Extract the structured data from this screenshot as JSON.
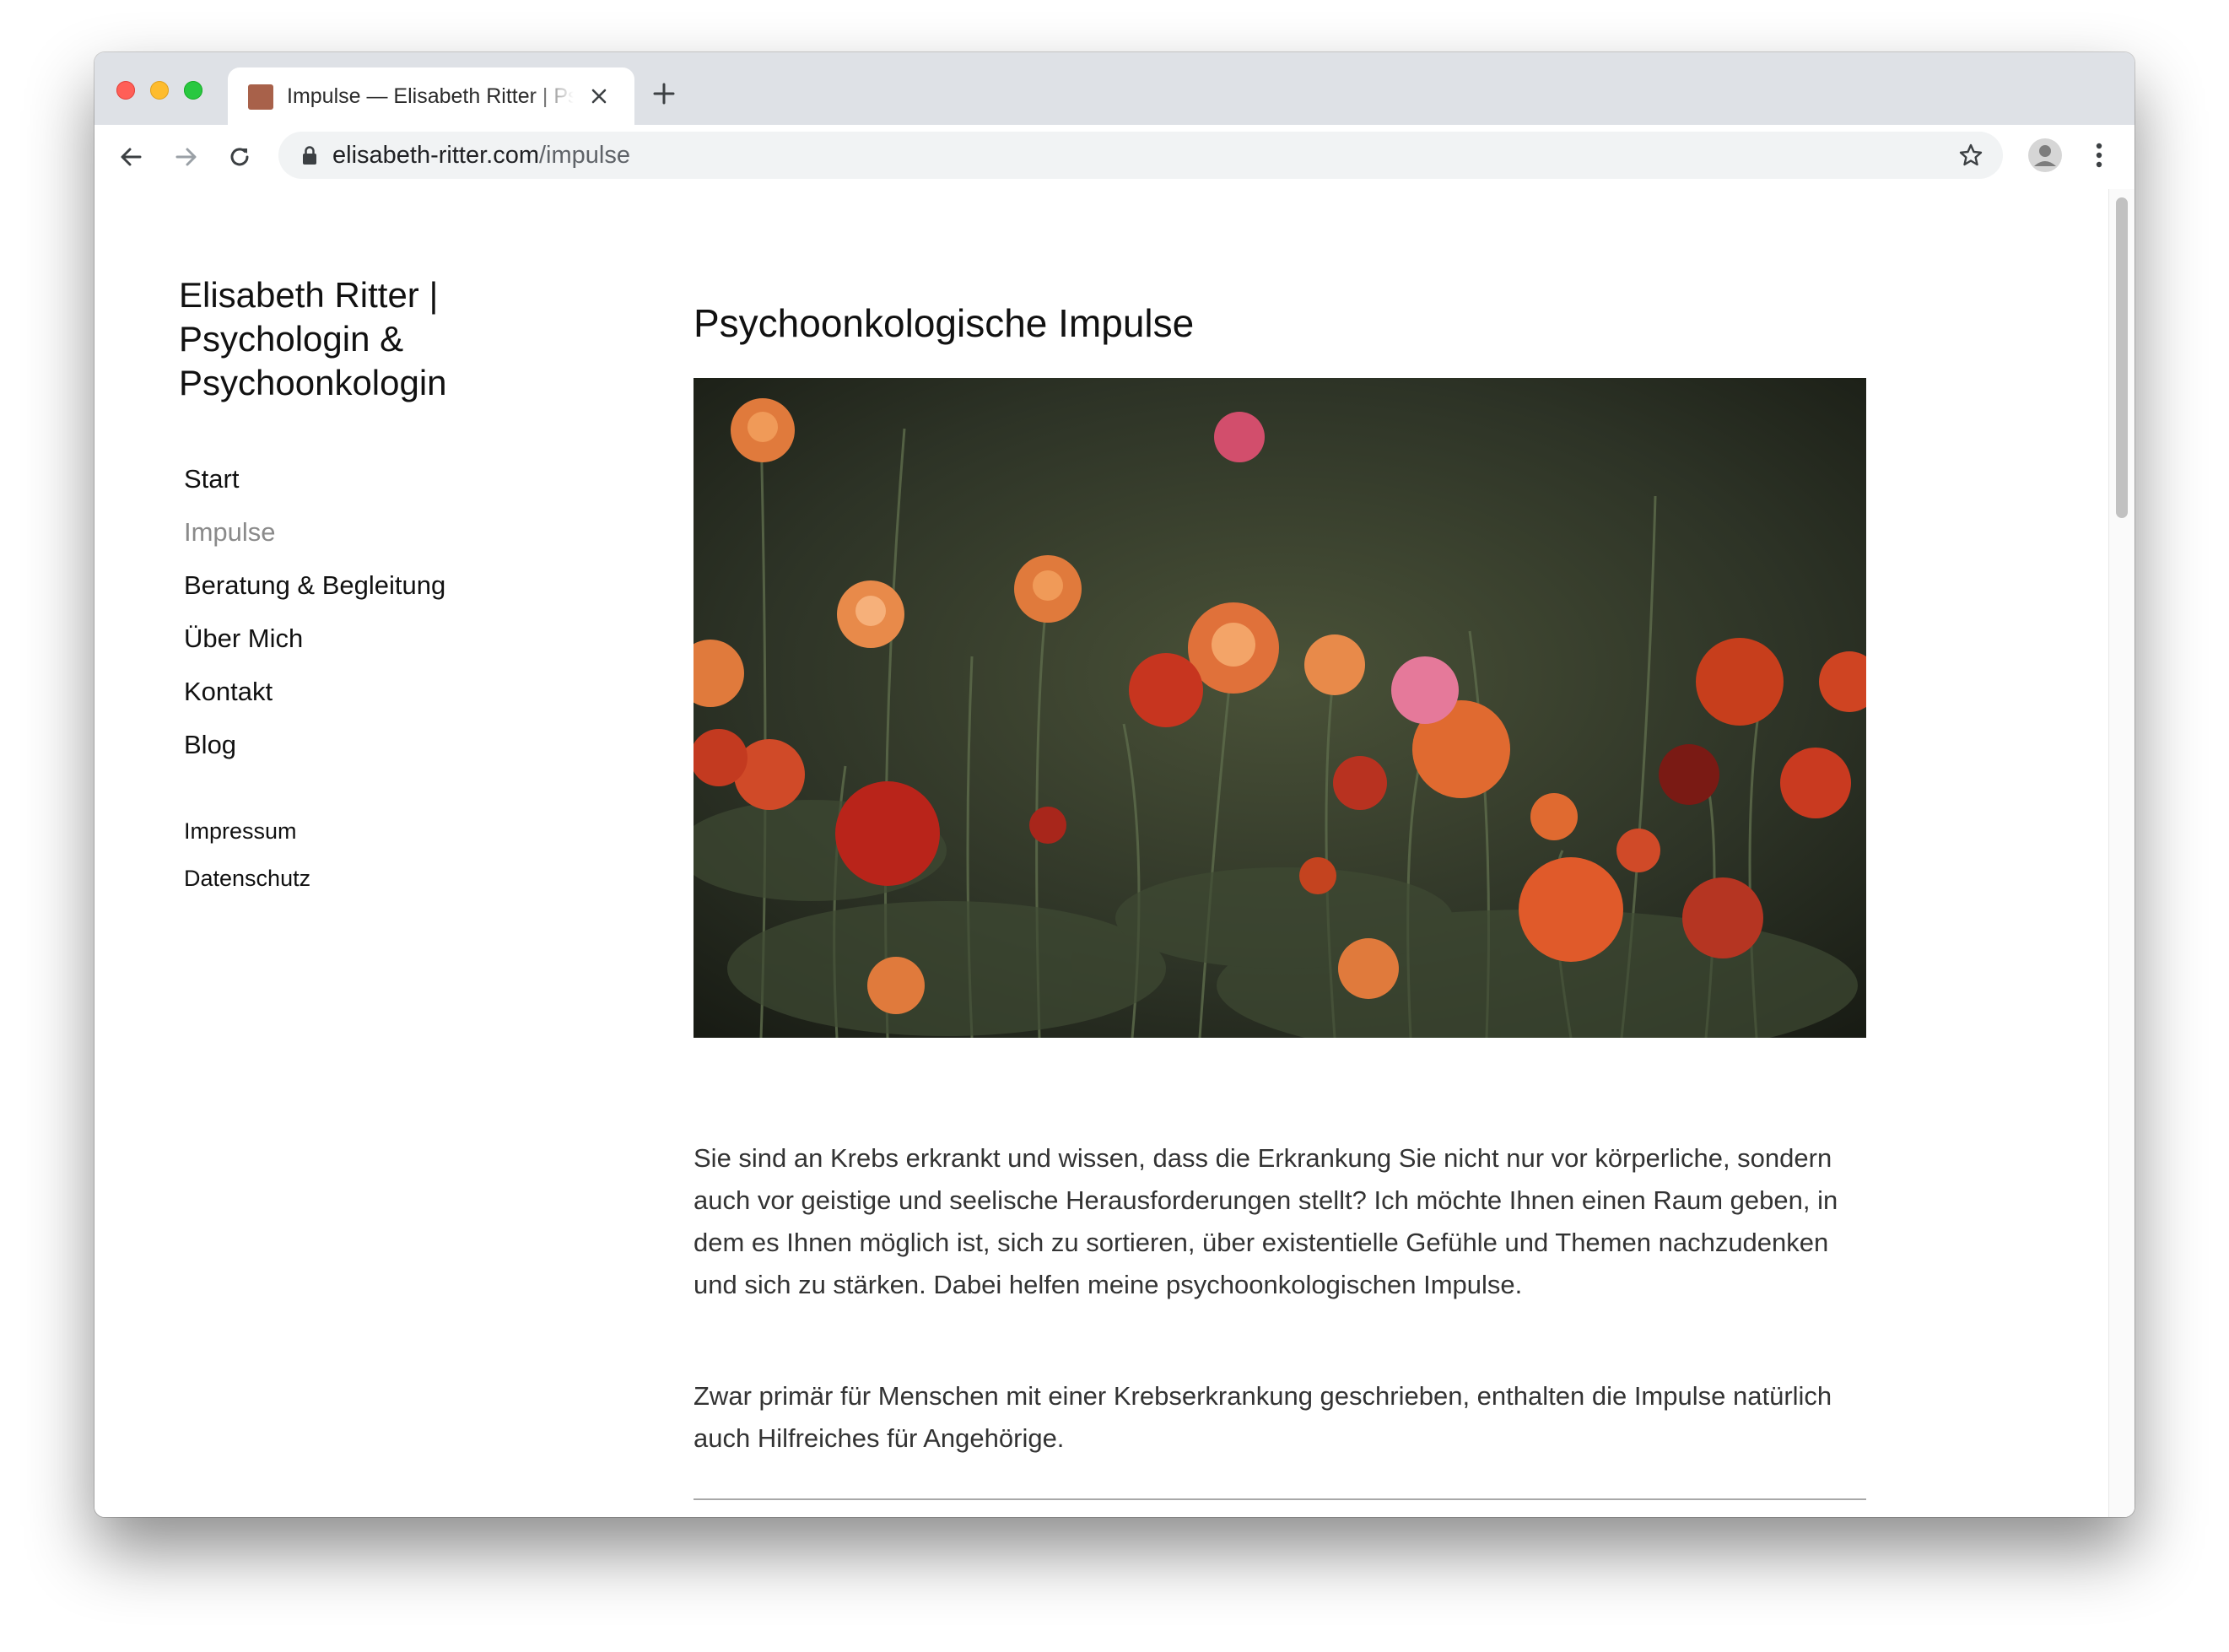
{
  "browser": {
    "tab": {
      "title": "Impulse — Elisabeth Ritter | Psychologin & Psychoonkologin"
    },
    "address_bar": {
      "domain": "elisabeth-ritter.com",
      "path": "/impulse"
    }
  },
  "sidebar": {
    "site_title": "Elisabeth Ritter | Psychologin & Psychoonkologin",
    "nav_items": [
      {
        "label": "Start"
      },
      {
        "label": "Impulse",
        "active": true
      },
      {
        "label": "Beratung & Begleitung"
      },
      {
        "label": "Über Mich"
      },
      {
        "label": "Kontakt"
      },
      {
        "label": "Blog"
      }
    ],
    "legal_links": [
      {
        "label": "Impressum"
      },
      {
        "label": "Datenschutz"
      }
    ]
  },
  "main": {
    "title": "Psychoonkologische Impulse",
    "paragraphs": [
      "Sie sind an Krebs erkrankt und wissen, dass die Erkrankung Sie nicht nur vor körperliche, sondern auch vor geistige und seelische Herausforderungen stellt? Ich möchte Ihnen einen Raum geben, in dem es Ihnen möglich ist, sich zu sortieren, über existentielle Gefühle und Themen nachzudenken und sich zu stärken. Dabei helfen meine psychoonkologischen Impulse.",
      "Zwar primär für Menschen mit einer Krebserkrankung geschrieben, enthalten die Impulse natürlich auch Hilfreiches für Angehörige."
    ]
  },
  "colors": {
    "accent_favicon": "#a8614a",
    "active_nav": "#8a8a8a",
    "text": "#333333"
  }
}
